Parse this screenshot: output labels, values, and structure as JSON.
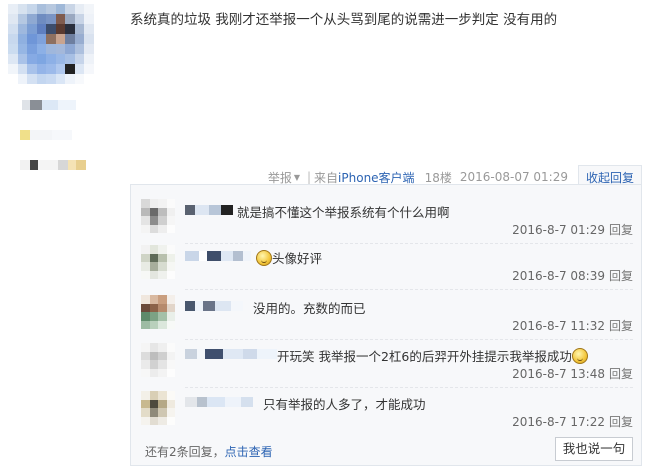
{
  "post": {
    "text": "系统真的垃圾 我刚才还举报一个从头骂到尾的说需进一步判定 没有用的",
    "report_label": "举报",
    "source_prefix": "来自",
    "source_link": "iPhone客户端",
    "floor": "18楼",
    "time": "2016-08-07 01:29",
    "collapse_label": "收起回复"
  },
  "replies": [
    {
      "text": "就是搞不懂这个举报系统有个什么用啊",
      "time": "2016-8-7 01:29",
      "reply_label": "回复"
    },
    {
      "text": "头像好评",
      "time": "2016-8-7 08:39",
      "reply_label": "回复"
    },
    {
      "text": "没用的。充数的而已",
      "time": "2016-8-7 11:32",
      "reply_label": "回复"
    },
    {
      "text": "开玩笑 我举报一个2杠6的后羿开外挂提示我举报成功",
      "time": "2016-8-7 13:48",
      "reply_label": "回复"
    },
    {
      "text": "只有举报的人多了，才能成功",
      "time": "2016-8-7 17:22",
      "reply_label": "回复"
    }
  ],
  "footer": {
    "more_prefix": "还有2条回复，",
    "more_link": "点击查看",
    "say_button": "我也说一句"
  },
  "colors": {
    "link": "#2d64b3",
    "reply_bg": "#f7f8fa",
    "border": "#e1e6ec"
  }
}
